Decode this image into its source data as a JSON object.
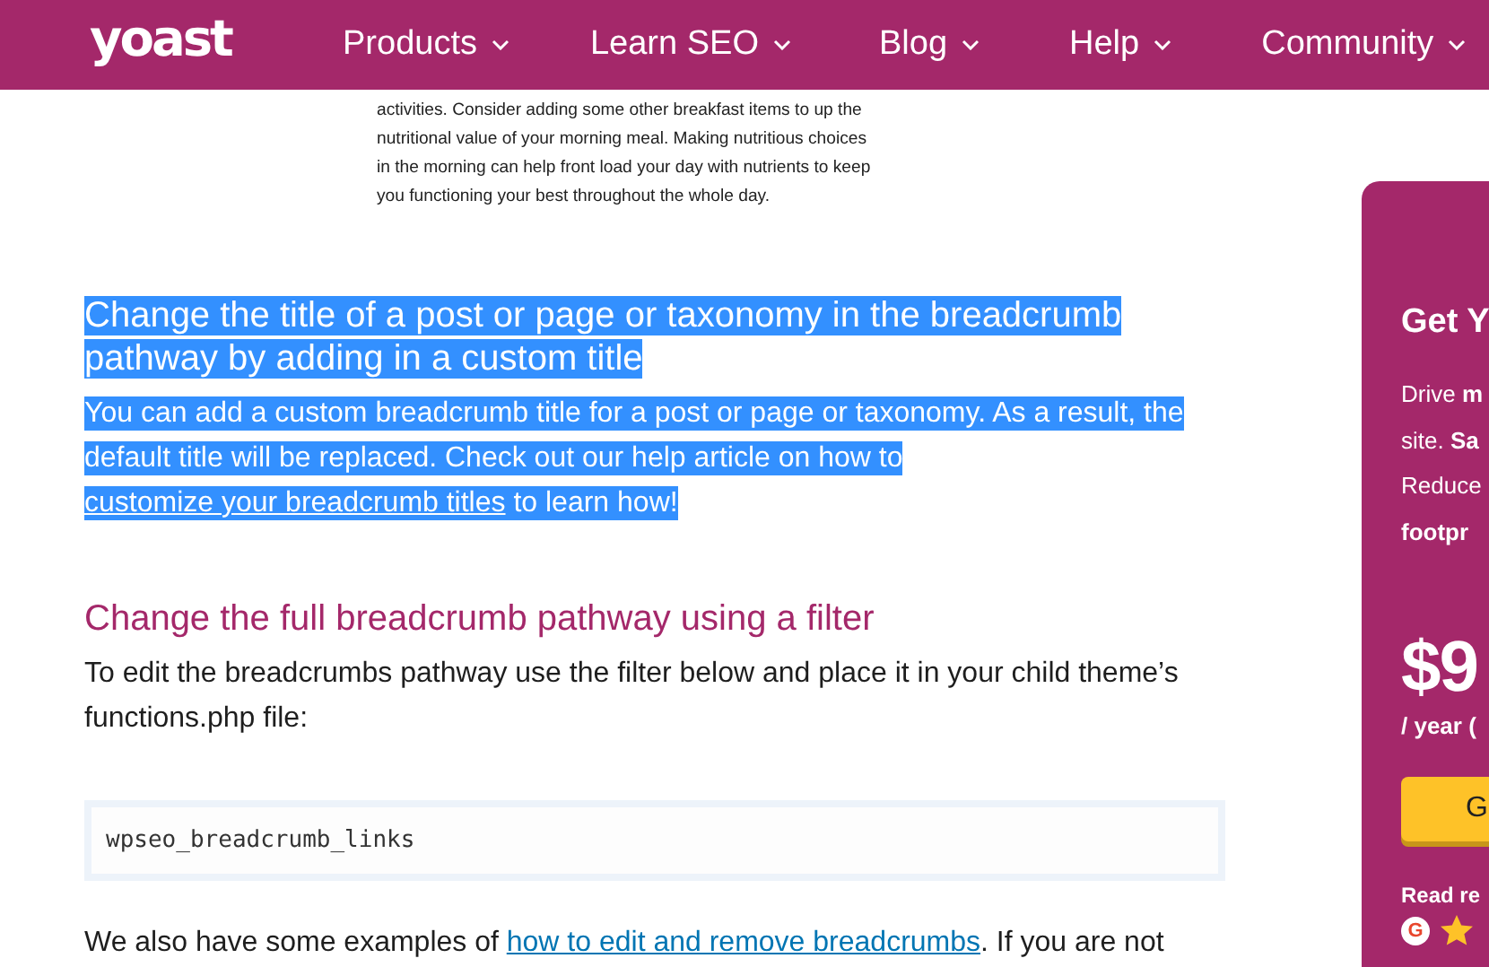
{
  "nav": {
    "logo": "yoast",
    "items": [
      {
        "label": "Products"
      },
      {
        "label": "Learn SEO"
      },
      {
        "label": "Blog"
      },
      {
        "label": "Help"
      },
      {
        "label": "Community"
      }
    ]
  },
  "article": {
    "image_text": "activities. Consider adding some other breakfast items to up the nutritional value of your morning meal. Making nutritious choices in the morning can help front load your day with nutrients to keep you functioning your best throughout the whole day.",
    "sections": [
      {
        "highlighted": true,
        "heading": "Change the title of a post or page or taxonomy in the breadcrumb pathway by adding in a custom title",
        "paragraph": {
          "before": "You can add a custom breadcrumb title for a post or page or taxonomy. As a result, the default title will be replaced. Check out our help article on how to ",
          "link": "customize your breadcrumb titles",
          "after": " to learn how!"
        }
      },
      {
        "highlighted": false,
        "heading": "Change the full breadcrumb pathway using a filter",
        "paragraph": {
          "before": "To edit the breadcrumbs pathway use the filter below and place it in your child theme’s functions.php file:"
        },
        "code": "wpseo_breadcrumb_links",
        "after_paragraph": {
          "before": "We also have some examples of ",
          "link": "how to edit and remove breadcrumbs",
          "after": ". If you are not"
        }
      }
    ]
  },
  "promo": {
    "title": "Get Y",
    "lines": [
      {
        "text": "Drive **m**",
        "bold": false
      },
      {
        "text": "site. **Sa**",
        "bold": false
      },
      {
        "text": "Reduce",
        "bold": false
      },
      {
        "text": "footpr",
        "bold": true
      }
    ],
    "price": "$9",
    "period": "/ year (",
    "button": "G",
    "reviews": "Read re",
    "rating_logo": "G"
  }
}
